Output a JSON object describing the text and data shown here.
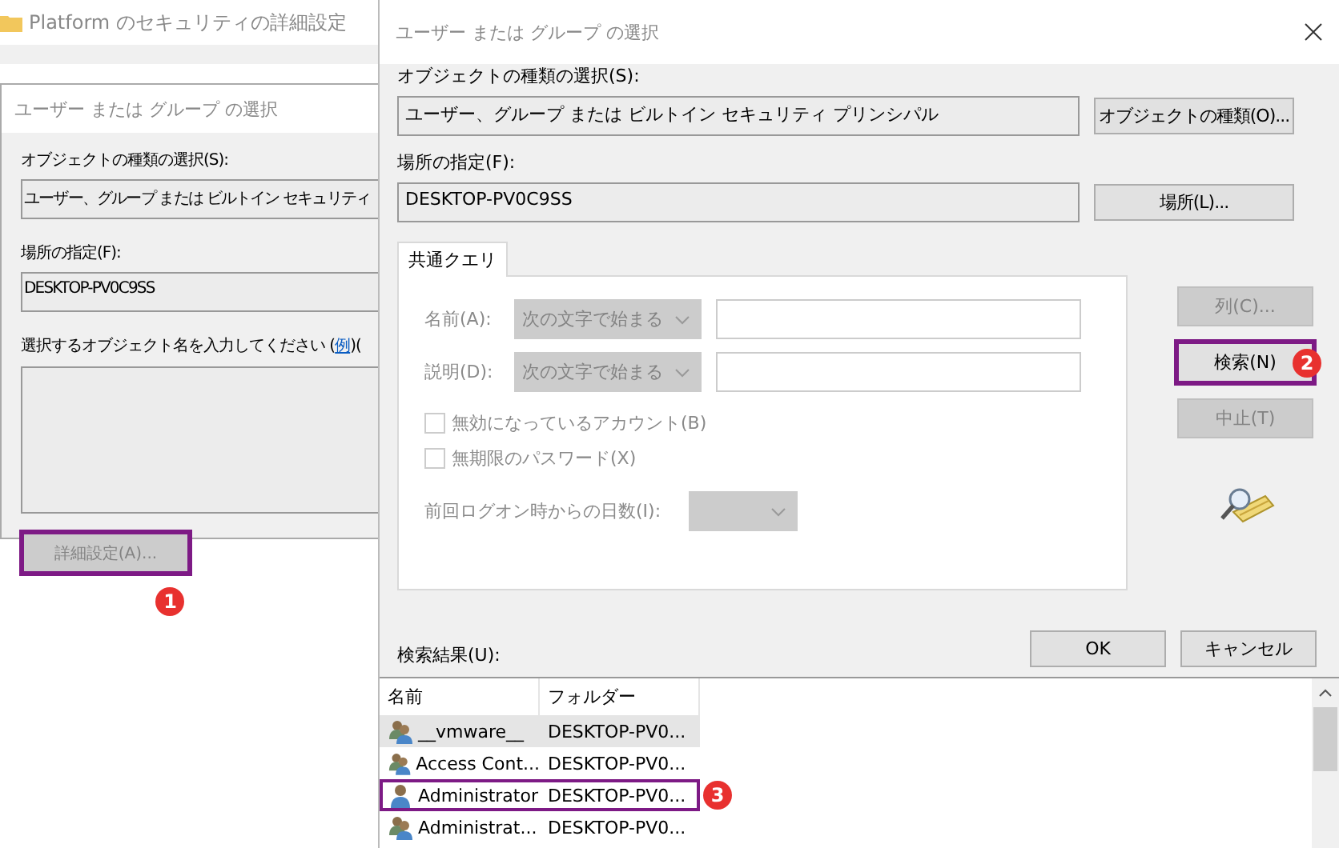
{
  "background_window": {
    "title": "Platform のセキュリティの詳細設定"
  },
  "back_dialog": {
    "title": "ユーザー または グループ の選択",
    "object_type_label": "オブジェクトの種類の選択(S):",
    "object_type_value": "ユーザー、グループ または ビルトイン セキュリティ",
    "location_label": "場所の指定(F):",
    "location_value": "DESKTOP-PV0C9SS",
    "names_prompt": "選択するオブジェクト名を入力してください (",
    "names_link": "例",
    "names_after": ")(",
    "advanced_button": {
      "label": "詳細設定(A)...",
      "highlighted": true,
      "callout": "1"
    }
  },
  "dialog": {
    "title": "ユーザー または グループ の選択",
    "object_type_label": "オブジェクトの種類の選択(S):",
    "object_type_value": "ユーザー、グループ または ビルトイン セキュリティ プリンシパル",
    "object_type_button": "オブジェクトの種類(O)...",
    "location_label": "場所の指定(F):",
    "location_value": "DESKTOP-PV0C9SS",
    "location_button": "場所(L)...",
    "tabs": [
      {
        "label": "共通クエリ",
        "selected": true
      }
    ],
    "query_rows": [
      {
        "label": "名前(A):",
        "operator": "次の文字で始まる",
        "disabled": true
      },
      {
        "label": "説明(D):",
        "operator": "次の文字で始まる",
        "disabled": true
      }
    ],
    "checkboxes": [
      {
        "label": "無効になっているアカウント(B)",
        "checked": false,
        "disabled": true
      },
      {
        "label": "無期限のパスワード(X)",
        "checked": false,
        "disabled": true
      }
    ],
    "days_label": "前回ログオン時からの日数(I):",
    "side_buttons": [
      {
        "label": "列(C)...",
        "disabled": true,
        "highlighted": false
      },
      {
        "label": "検索(N)",
        "disabled": false,
        "highlighted": true,
        "callout": "2"
      },
      {
        "label": "中止(T)",
        "disabled": true,
        "highlighted": false
      }
    ],
    "ok_button": "OK",
    "cancel_button": "キャンセル",
    "results_label": "検索結果(U):",
    "results": {
      "columns": [
        "名前",
        "フォルダー"
      ],
      "rows": [
        {
          "kind": "group",
          "name": "__vmware__",
          "folder": "DESKTOP-PV0...",
          "selected": true,
          "highlighted": false
        },
        {
          "kind": "group",
          "name": "Access Cont...",
          "folder": "DESKTOP-PV0...",
          "selected": false,
          "highlighted": false
        },
        {
          "kind": "user",
          "name": "Administrator",
          "folder": "DESKTOP-PV0...",
          "selected": false,
          "highlighted": true,
          "callout": "3"
        },
        {
          "kind": "group",
          "name": "Administrat...",
          "folder": "DESKTOP-PV0...",
          "selected": false,
          "highlighted": false
        }
      ]
    }
  }
}
